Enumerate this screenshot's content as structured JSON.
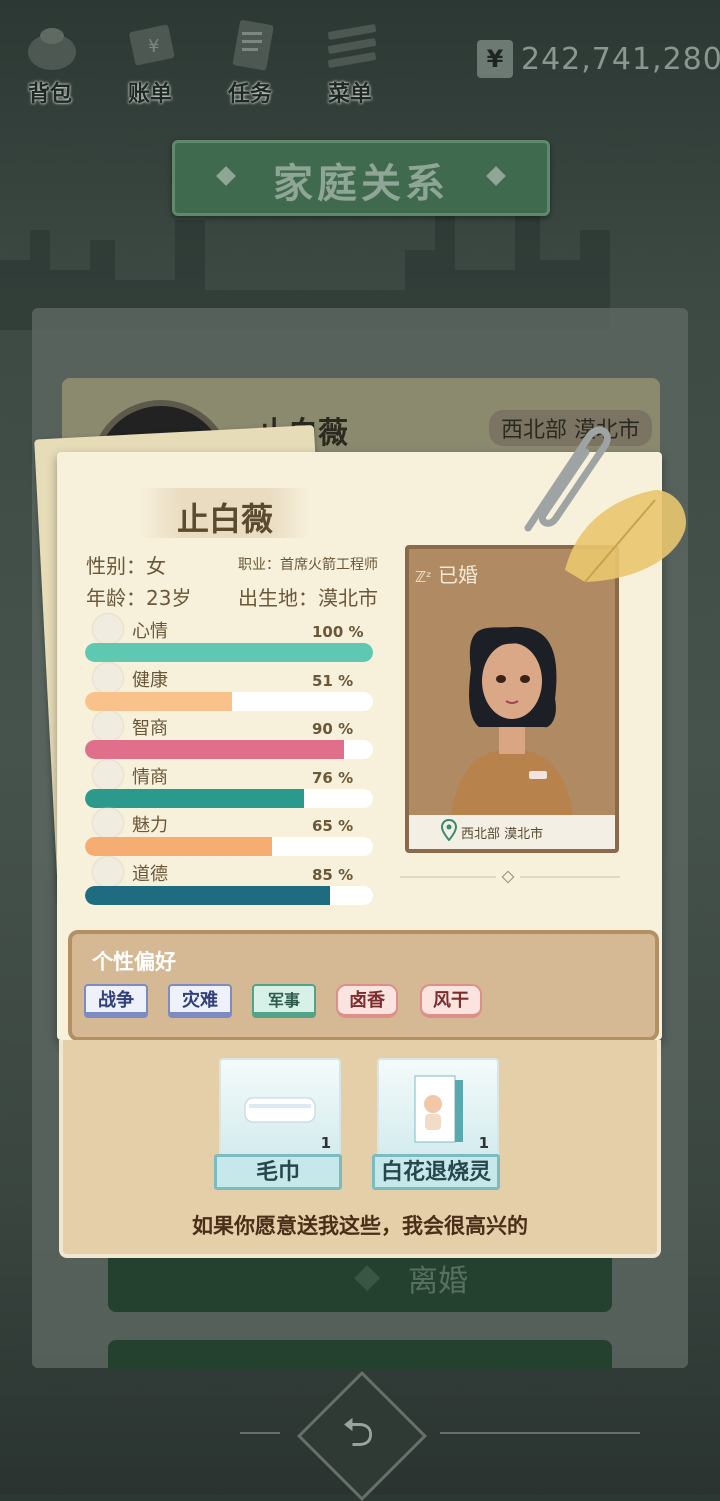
{
  "topbar": {
    "items": [
      {
        "label": "背包",
        "icon": "backpack-icon"
      },
      {
        "label": "账单",
        "icon": "bill-icon"
      },
      {
        "label": "任务",
        "icon": "task-icon"
      },
      {
        "label": "菜单",
        "icon": "menu-icon"
      }
    ],
    "money": {
      "currency": "¥",
      "value": "242,741,280"
    }
  },
  "page_title": "家庭关系",
  "back_card": {
    "name": "止白薇",
    "location": "西北部 漠北市"
  },
  "profile": {
    "name": "止白薇",
    "gender_label": "性别：女",
    "job_label": "职业：首席火箭工程师",
    "age_label": "年龄：23岁",
    "birthplace_label": "出生地：漠北市",
    "marital_status": "已婚",
    "portrait_location": "西北部 漠北市"
  },
  "stats": [
    {
      "name": "心情",
      "pct_text": "100 %",
      "value": 100,
      "color": "#5ec9b0",
      "icon": "smile-icon"
    },
    {
      "name": "健康",
      "pct_text": "51 %",
      "value": 51,
      "color": "#f8c28a",
      "icon": "heart-icon"
    },
    {
      "name": "智商",
      "pct_text": "90 %",
      "value": 90,
      "color": "#e06f8c",
      "icon": "bulb-icon"
    },
    {
      "name": "情商",
      "pct_text": "76 %",
      "value": 76,
      "color": "#2b9a8c",
      "icon": "apple-icon"
    },
    {
      "name": "魅力",
      "pct_text": "65 %",
      "value": 65,
      "color": "#f5ad72",
      "icon": "sparkle-icon"
    },
    {
      "name": "道德",
      "pct_text": "85 %",
      "value": 85,
      "color": "#1f6b80",
      "icon": "scale-icon"
    }
  ],
  "preferences": {
    "heading": "个性偏好",
    "tags": [
      {
        "label": "战争",
        "style": "blue"
      },
      {
        "label": "灾难",
        "style": "blue"
      },
      {
        "label": "军事",
        "style": "green"
      },
      {
        "label": "卤香",
        "style": "pink"
      },
      {
        "label": "风干",
        "style": "pink"
      }
    ]
  },
  "gifts": {
    "items": [
      {
        "name": "毛巾",
        "count": "1",
        "icon": "towel-icon"
      },
      {
        "name": "白花退烧灵",
        "count": "1",
        "icon": "medicine-box-icon"
      }
    ],
    "message": "如果你愿意送我这些，我会很高兴的"
  },
  "buttons": {
    "divorce_label": "离婚"
  }
}
